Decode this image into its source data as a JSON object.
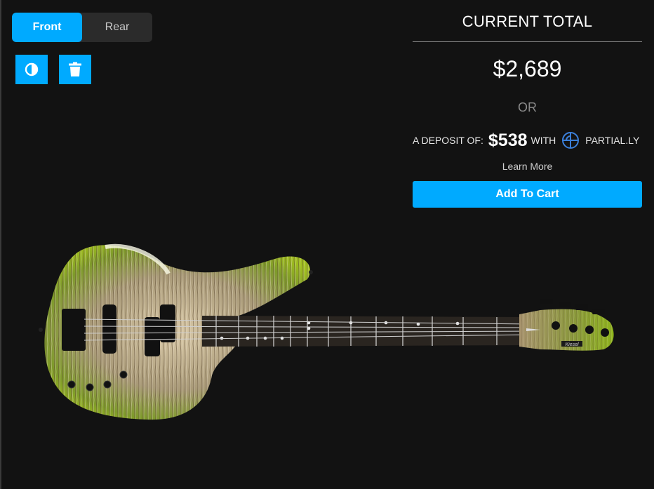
{
  "view_toggle": {
    "front_label": "Front",
    "rear_label": "Rear",
    "selected": "Front"
  },
  "tools": {
    "contrast_icon": "contrast-icon",
    "delete_icon": "trash-icon"
  },
  "summary": {
    "title": "CURRENT TOTAL",
    "price": "$2,689",
    "or_label": "OR",
    "deposit_prefix": "A DEPOSIT OF:",
    "deposit_amount": "$538",
    "deposit_with": "WITH",
    "partner_brand": "PARTIAL.LY",
    "partner_icon": "partially-logo-icon",
    "learn_more": "Learn More",
    "add_to_cart": "Add To Cart"
  },
  "colors": {
    "accent": "#00aaff",
    "background": "#121212",
    "body_finish": "#8fae1b"
  },
  "preview": {
    "image": "bass-guitar-preview",
    "headstock_logo": "Kiesel"
  }
}
